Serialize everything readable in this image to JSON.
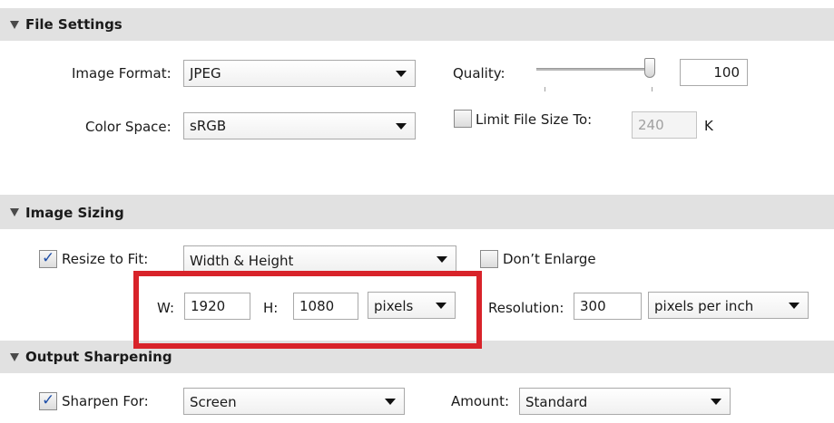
{
  "file_settings": {
    "header": "File Settings",
    "image_format_label": "Image Format:",
    "image_format_value": "JPEG",
    "quality_label": "Quality:",
    "quality_value": "100",
    "color_space_label": "Color Space:",
    "color_space_value": "sRGB",
    "limit_file_size_label": "Limit File Size To:",
    "limit_file_size_value": "240",
    "limit_file_size_unit": "K",
    "limit_file_size_checked": false
  },
  "image_sizing": {
    "header": "Image Sizing",
    "resize_to_fit_label": "Resize to Fit:",
    "resize_to_fit_checked": true,
    "resize_mode_value": "Width & Height",
    "dont_enlarge_label": "Don’t Enlarge",
    "dont_enlarge_checked": false,
    "w_label": "W:",
    "w_value": "1920",
    "h_label": "H:",
    "h_value": "1080",
    "units_value": "pixels",
    "resolution_label": "Resolution:",
    "resolution_value": "300",
    "resolution_unit_value": "pixels per inch"
  },
  "output_sharpening": {
    "header": "Output Sharpening",
    "sharpen_for_label": "Sharpen For:",
    "sharpen_for_checked": true,
    "sharpen_for_value": "Screen",
    "amount_label": "Amount:",
    "amount_value": "Standard"
  },
  "icons": {
    "collapse": "triangle-down-icon",
    "dropdown": "chevron-down-icon",
    "check": "checkmark-icon"
  },
  "colors": {
    "header_bg": "#e1e1e1",
    "highlight": "#d8232a",
    "check": "#1f4fa8"
  }
}
